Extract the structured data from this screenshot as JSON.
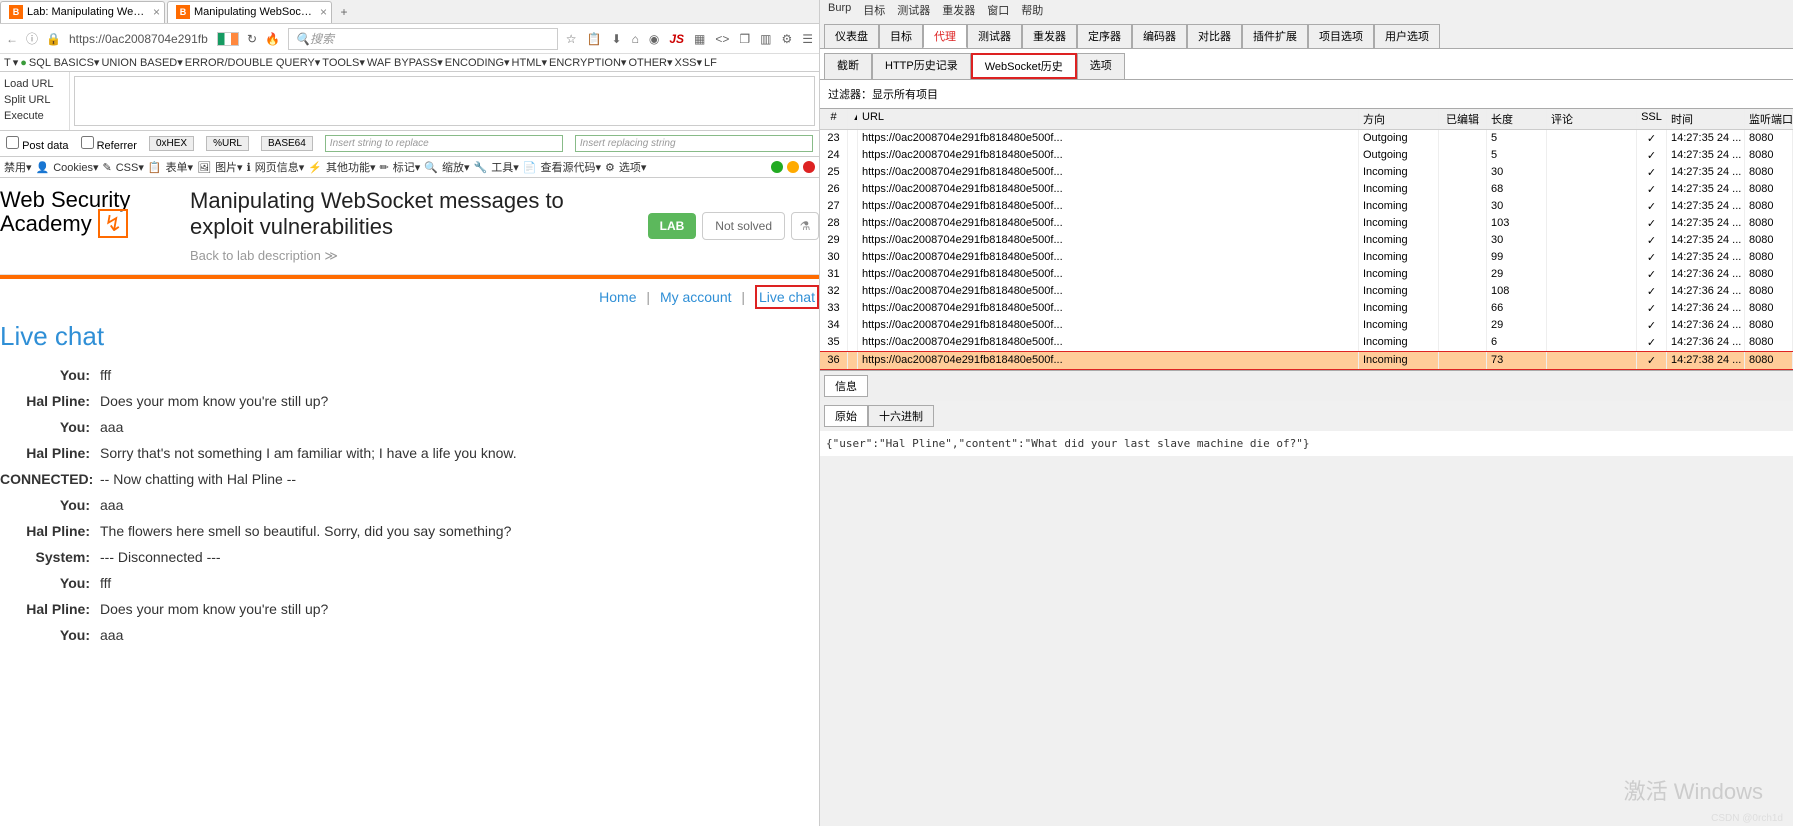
{
  "browser": {
    "tabs": [
      {
        "label": "Lab: Manipulating Web..."
      },
      {
        "label": "Manipulating WebSock..."
      }
    ],
    "url": "https://0ac2008704e291fb",
    "search_placeholder": "搜索",
    "hackside": [
      "Load URL",
      "Split URL",
      "Execute"
    ],
    "menubar": [
      "T",
      "SQL BASICS▾",
      "UNION BASED▾",
      "ERROR/DOUBLE QUERY▾",
      "TOOLS▾",
      "WAF BYPASS▾",
      "ENCODING▾",
      "HTML▾",
      "ENCRYPTION▾",
      "OTHER▾",
      "XSS▾",
      "LF"
    ],
    "checks": {
      "postdata": "Post data",
      "referrer": "Referrer"
    },
    "encbtns": [
      "0xHEX",
      "%URL",
      "BASE64"
    ],
    "repl1": "Insert string to replace",
    "repl2": "Insert replacing string",
    "toolbar2": [
      "禁用▾",
      "Cookies▾",
      "CSS▾",
      "表单▾",
      "图片▾",
      "网页信息▾",
      "其他功能▾",
      "标记▾",
      "缩放▾",
      "工具▾",
      "查看源代码▾",
      "选项▾"
    ]
  },
  "academy": {
    "logo1": "Web Security",
    "logo2": "Academy",
    "title": "Manipulating WebSocket messages to exploit vulnerabilities",
    "back": "Back to lab description  ≫",
    "lab_badge": "LAB",
    "not_solved": "Not solved"
  },
  "nav": {
    "home": "Home",
    "account": "My account",
    "chat": "Live chat"
  },
  "chat": {
    "title": "Live chat",
    "rows": [
      {
        "who": "You:",
        "msg": "fff"
      },
      {
        "who": "Hal Pline:",
        "msg": "Does your mom know you're still up?"
      },
      {
        "who": "You:",
        "msg": "aaa"
      },
      {
        "who": "Hal Pline:",
        "msg": "Sorry that's not something I am familiar with; I have a life you know."
      },
      {
        "who": "CONNECTED:",
        "msg": "-- Now chatting with Hal Pline --"
      },
      {
        "who": "You:",
        "msg": "aaa"
      },
      {
        "who": "Hal Pline:",
        "msg": "The flowers here smell so beautiful. Sorry, did you say something?"
      },
      {
        "who": "System:",
        "msg": "--- Disconnected ---"
      },
      {
        "who": "You:",
        "msg": "fff"
      },
      {
        "who": "Hal Pline:",
        "msg": "Does your mom know you're still up?"
      },
      {
        "who": "You:",
        "msg": "aaa"
      }
    ]
  },
  "burp": {
    "menu": [
      "Burp",
      "目标",
      "测试器",
      "重发器",
      "窗口",
      "帮助"
    ],
    "tabs": [
      "仪表盘",
      "目标",
      "代理",
      "测试器",
      "重发器",
      "定序器",
      "编码器",
      "对比器",
      "插件扩展",
      "项目选项",
      "用户选项"
    ],
    "subtabs": [
      "截断",
      "HTTP历史记录",
      "WebSocket历史",
      "选项"
    ],
    "filter": "过滤器：显示所有项目",
    "cols": [
      "#",
      "URL",
      "方向",
      "已编辑",
      "长度",
      "评论",
      "SSL",
      "时间",
      "监听端口"
    ],
    "rows": [
      {
        "id": "23",
        "url": "https://0ac2008704e291fb818480e500f...",
        "dir": "Outgoing",
        "len": "5",
        "ssl": "✓",
        "time": "14:27:35 24 ...",
        "port": "8080"
      },
      {
        "id": "24",
        "url": "https://0ac2008704e291fb818480e500f...",
        "dir": "Outgoing",
        "len": "5",
        "ssl": "✓",
        "time": "14:27:35 24 ...",
        "port": "8080"
      },
      {
        "id": "25",
        "url": "https://0ac2008704e291fb818480e500f...",
        "dir": "Incoming",
        "len": "30",
        "ssl": "✓",
        "time": "14:27:35 24 ...",
        "port": "8080"
      },
      {
        "id": "26",
        "url": "https://0ac2008704e291fb818480e500f...",
        "dir": "Incoming",
        "len": "68",
        "ssl": "✓",
        "time": "14:27:35 24 ...",
        "port": "8080"
      },
      {
        "id": "27",
        "url": "https://0ac2008704e291fb818480e500f...",
        "dir": "Incoming",
        "len": "30",
        "ssl": "✓",
        "time": "14:27:35 24 ...",
        "port": "8080"
      },
      {
        "id": "28",
        "url": "https://0ac2008704e291fb818480e500f...",
        "dir": "Incoming",
        "len": "103",
        "ssl": "✓",
        "time": "14:27:35 24 ...",
        "port": "8080"
      },
      {
        "id": "29",
        "url": "https://0ac2008704e291fb818480e500f...",
        "dir": "Incoming",
        "len": "30",
        "ssl": "✓",
        "time": "14:27:35 24 ...",
        "port": "8080"
      },
      {
        "id": "30",
        "url": "https://0ac2008704e291fb818480e500f...",
        "dir": "Incoming",
        "len": "99",
        "ssl": "✓",
        "time": "14:27:35 24 ...",
        "port": "8080"
      },
      {
        "id": "31",
        "url": "https://0ac2008704e291fb818480e500f...",
        "dir": "Incoming",
        "len": "29",
        "ssl": "✓",
        "time": "14:27:36 24 ...",
        "port": "8080"
      },
      {
        "id": "32",
        "url": "https://0ac2008704e291fb818480e500f...",
        "dir": "Incoming",
        "len": "108",
        "ssl": "✓",
        "time": "14:27:36 24 ...",
        "port": "8080"
      },
      {
        "id": "33",
        "url": "https://0ac2008704e291fb818480e500f...",
        "dir": "Incoming",
        "len": "66",
        "ssl": "✓",
        "time": "14:27:36 24 ...",
        "port": "8080"
      },
      {
        "id": "34",
        "url": "https://0ac2008704e291fb818480e500f...",
        "dir": "Incoming",
        "len": "29",
        "ssl": "✓",
        "time": "14:27:36 24 ...",
        "port": "8080"
      },
      {
        "id": "35",
        "url": "https://0ac2008704e291fb818480e500f...",
        "dir": "Incoming",
        "len": "6",
        "ssl": "✓",
        "time": "14:27:36 24 ...",
        "port": "8080"
      },
      {
        "id": "36",
        "url": "https://0ac2008704e291fb818480e500f...",
        "dir": "Incoming",
        "len": "73",
        "ssl": "✓",
        "time": "14:27:38 24 ...",
        "port": "8080",
        "sel": true
      }
    ],
    "infotab": "信息",
    "msgtabs": [
      "原始",
      "十六进制"
    ],
    "msgbody": "{\"user\":\"Hal Pline\",\"content\":\"What did your last slave machine die of?\"}"
  },
  "watermark": "激活 Windows",
  "csdn": "CSDN @0rch1d"
}
